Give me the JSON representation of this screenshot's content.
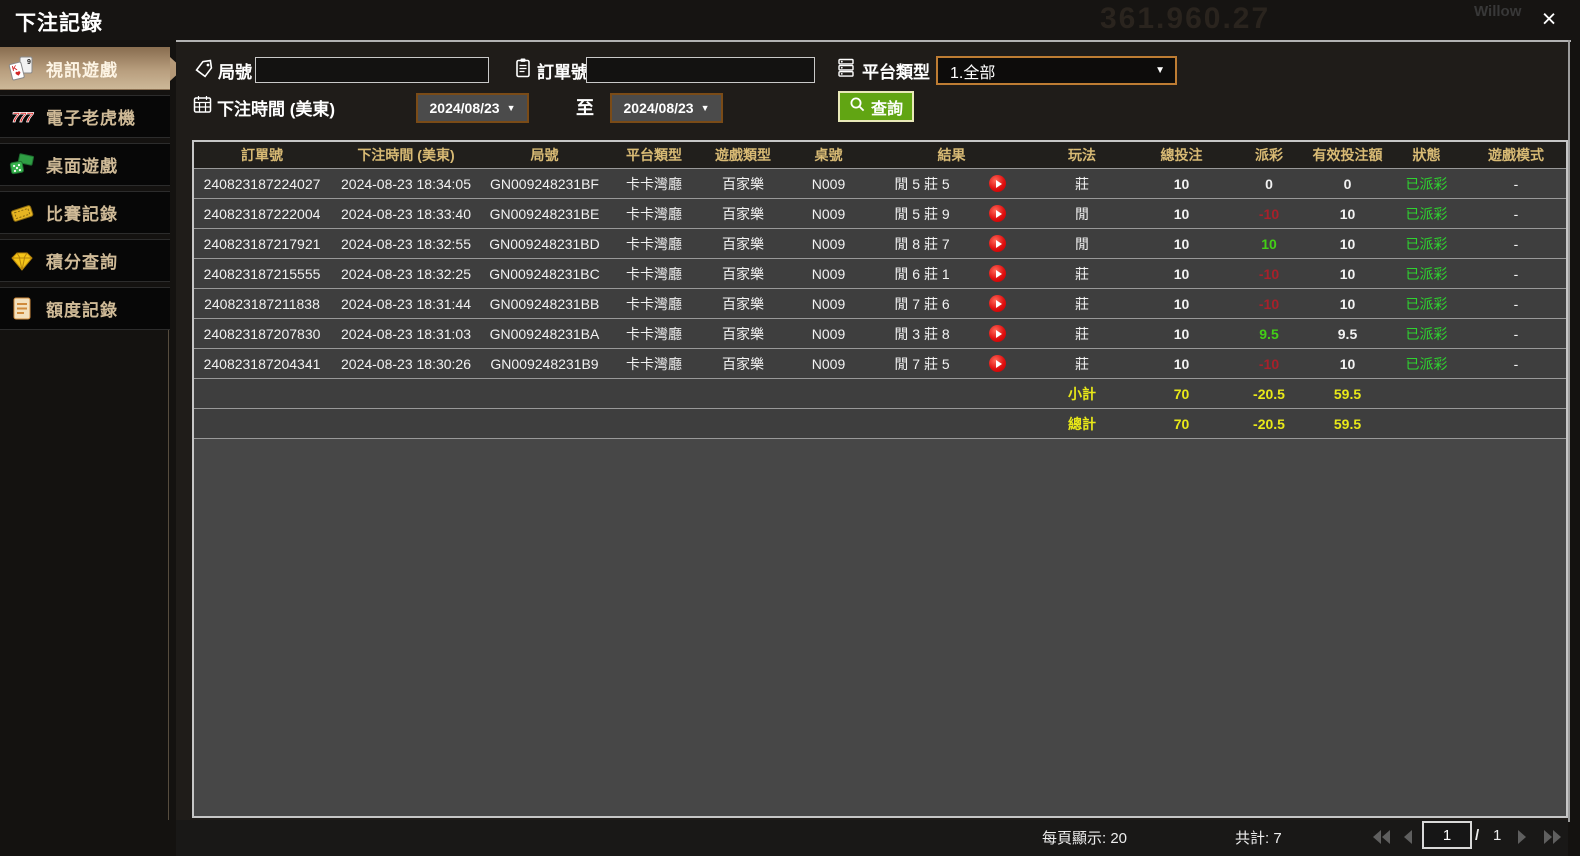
{
  "title_bar": {
    "title": "下注記錄",
    "close_glyph": "×",
    "background_bleed": {
      "balance": "361.960.27",
      "username": "Willow"
    }
  },
  "sidebar": {
    "items": [
      {
        "label": "視訊遊戲",
        "icon": "cards-icon",
        "active": true
      },
      {
        "label": "電子老虎機",
        "icon": "slots-777-icon",
        "active": false
      },
      {
        "label": "桌面遊戲",
        "icon": "dice-icon",
        "active": false
      },
      {
        "label": "比賽記錄",
        "icon": "ticket-icon",
        "active": false
      },
      {
        "label": "積分查詢",
        "icon": "diamond-icon",
        "active": false
      },
      {
        "label": "額度記錄",
        "icon": "document-icon",
        "active": false
      }
    ]
  },
  "filters": {
    "round_label": "局號",
    "round_value": "",
    "order_label": "訂單號",
    "order_value": "",
    "platform_label": "平台類型",
    "platform_value": "1.全部",
    "dropdown_arrow": "▼",
    "time_label": "下注時間 (美東)",
    "date_from": "2024/08/23",
    "to_label": "至",
    "date_to": "2024/08/23",
    "search_label": "查詢"
  },
  "table": {
    "headers": [
      "訂單號",
      "下注時間 (美東)",
      "局號",
      "平台類型",
      "遊戲類型",
      "桌號",
      "結果",
      "玩法",
      "總投注",
      "派彩",
      "有效投注額",
      "狀態",
      "遊戲模式"
    ],
    "rows": [
      {
        "order": "240823187224027",
        "time": "2024-08-23 18:34:05",
        "round": "GN009248231BF",
        "platform": "卡卡灣廳",
        "game": "百家樂",
        "table_no": "N009",
        "result": "閒 5 莊 5",
        "play": "莊",
        "total_bet": "10",
        "payout": "0",
        "payout_tone": "zero",
        "valid_bet": "0",
        "status": "已派彩",
        "mode": "-"
      },
      {
        "order": "240823187222004",
        "time": "2024-08-23 18:33:40",
        "round": "GN009248231BE",
        "platform": "卡卡灣廳",
        "game": "百家樂",
        "table_no": "N009",
        "result": "閒 5 莊 9",
        "play": "閒",
        "total_bet": "10",
        "payout": "-10",
        "payout_tone": "neg",
        "valid_bet": "10",
        "status": "已派彩",
        "mode": "-"
      },
      {
        "order": "240823187217921",
        "time": "2024-08-23 18:32:55",
        "round": "GN009248231BD",
        "platform": "卡卡灣廳",
        "game": "百家樂",
        "table_no": "N009",
        "result": "閒 8 莊 7",
        "play": "閒",
        "total_bet": "10",
        "payout": "10",
        "payout_tone": "pos",
        "valid_bet": "10",
        "status": "已派彩",
        "mode": "-"
      },
      {
        "order": "240823187215555",
        "time": "2024-08-23 18:32:25",
        "round": "GN009248231BC",
        "platform": "卡卡灣廳",
        "game": "百家樂",
        "table_no": "N009",
        "result": "閒 6 莊 1",
        "play": "莊",
        "total_bet": "10",
        "payout": "-10",
        "payout_tone": "neg",
        "valid_bet": "10",
        "status": "已派彩",
        "mode": "-"
      },
      {
        "order": "240823187211838",
        "time": "2024-08-23 18:31:44",
        "round": "GN009248231BB",
        "platform": "卡卡灣廳",
        "game": "百家樂",
        "table_no": "N009",
        "result": "閒 7 莊 6",
        "play": "莊",
        "total_bet": "10",
        "payout": "-10",
        "payout_tone": "neg",
        "valid_bet": "10",
        "status": "已派彩",
        "mode": "-"
      },
      {
        "order": "240823187207830",
        "time": "2024-08-23 18:31:03",
        "round": "GN009248231BA",
        "platform": "卡卡灣廳",
        "game": "百家樂",
        "table_no": "N009",
        "result": "閒 3 莊 8",
        "play": "莊",
        "total_bet": "10",
        "payout": "9.5",
        "payout_tone": "pos",
        "valid_bet": "9.5",
        "status": "已派彩",
        "mode": "-"
      },
      {
        "order": "240823187204341",
        "time": "2024-08-23 18:30:26",
        "round": "GN009248231B9",
        "platform": "卡卡灣廳",
        "game": "百家樂",
        "table_no": "N009",
        "result": "閒 7 莊 5",
        "play": "莊",
        "total_bet": "10",
        "payout": "-10",
        "payout_tone": "neg",
        "valid_bet": "10",
        "status": "已派彩",
        "mode": "-"
      }
    ],
    "subtotal": {
      "label": "小計",
      "total_bet": "70",
      "payout": "-20.5",
      "valid_bet": "59.5"
    },
    "total": {
      "label": "總計",
      "total_bet": "70",
      "payout": "-20.5",
      "valid_bet": "59.5"
    }
  },
  "footer": {
    "per_page_label": "每頁顯示:",
    "per_page_value": "20",
    "total_count_label": "共計:",
    "total_count_value": "7",
    "page_value": "1",
    "page_separator": "/",
    "page_total": "1"
  },
  "colors": {
    "header_gold": "#d8ba74",
    "sidebar_tan": "#cfba97",
    "active_item_bg": "#b89e7e",
    "negative_red": "#a6202a",
    "positive_green": "#43cf17",
    "status_green": "#2fd32f",
    "summary_yellow": "#e9e918",
    "search_button_green": "#61a513",
    "dropdown_border_orange": "#bd7c33",
    "replay_red": "#e01010"
  }
}
